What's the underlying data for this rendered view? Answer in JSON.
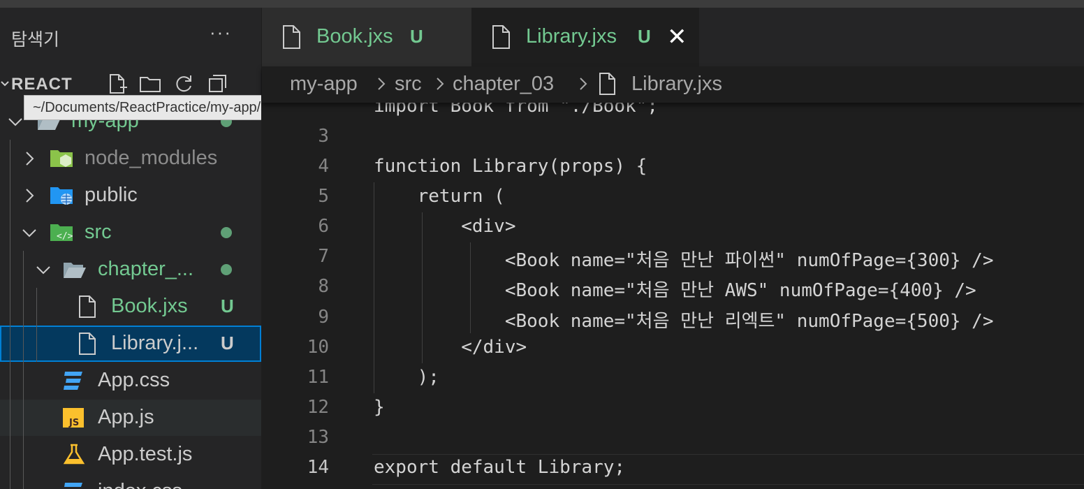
{
  "sidebar": {
    "title": "탐색기",
    "more": "···",
    "section_title": "REACT",
    "tooltip": "~/Documents/ReactPractice/my-app/src/App.js",
    "items": [
      {
        "label": "my-app"
      },
      {
        "label": "node_modules"
      },
      {
        "label": "public"
      },
      {
        "label": "src"
      },
      {
        "label": "chapter_..."
      },
      {
        "label": "Book.jxs",
        "badge": "U"
      },
      {
        "label": "Library.j...",
        "badge": "U"
      },
      {
        "label": "App.css"
      },
      {
        "label": "App.js"
      },
      {
        "label": "App.test.js"
      },
      {
        "label": "index.css"
      }
    ]
  },
  "tabs": [
    {
      "label": "Book.jxs",
      "badge": "U"
    },
    {
      "label": "Library.jxs",
      "badge": "U",
      "close": "✕"
    }
  ],
  "breadcrumb": [
    "my-app",
    "src",
    "chapter_03",
    "Library.jxs"
  ],
  "editor": {
    "current_line": "14",
    "lines": [
      {
        "num": "",
        "text": "import Book from \"./Book\";"
      },
      {
        "num": "3",
        "text": ""
      },
      {
        "num": "4",
        "text": "function Library(props) {"
      },
      {
        "num": "5",
        "text": "    return ("
      },
      {
        "num": "6",
        "text": "        <div>"
      },
      {
        "num": "7",
        "text": "            <Book name=\"처음 만난 파이썬\" numOfPage={300} />"
      },
      {
        "num": "8",
        "text": "            <Book name=\"처음 만난 AWS\" numOfPage={400} />"
      },
      {
        "num": "9",
        "text": "            <Book name=\"처음 만난 리엑트\" numOfPage={500} />"
      },
      {
        "num": "10",
        "text": "        </div>"
      },
      {
        "num": "11",
        "text": "    );"
      },
      {
        "num": "12",
        "text": "}"
      },
      {
        "num": "13",
        "text": ""
      },
      {
        "num": "14",
        "text": "export default Library;"
      }
    ]
  },
  "colors": {
    "git_untracked": "#73c991",
    "selection": "#04395e",
    "focus_border": "#007fd4"
  }
}
